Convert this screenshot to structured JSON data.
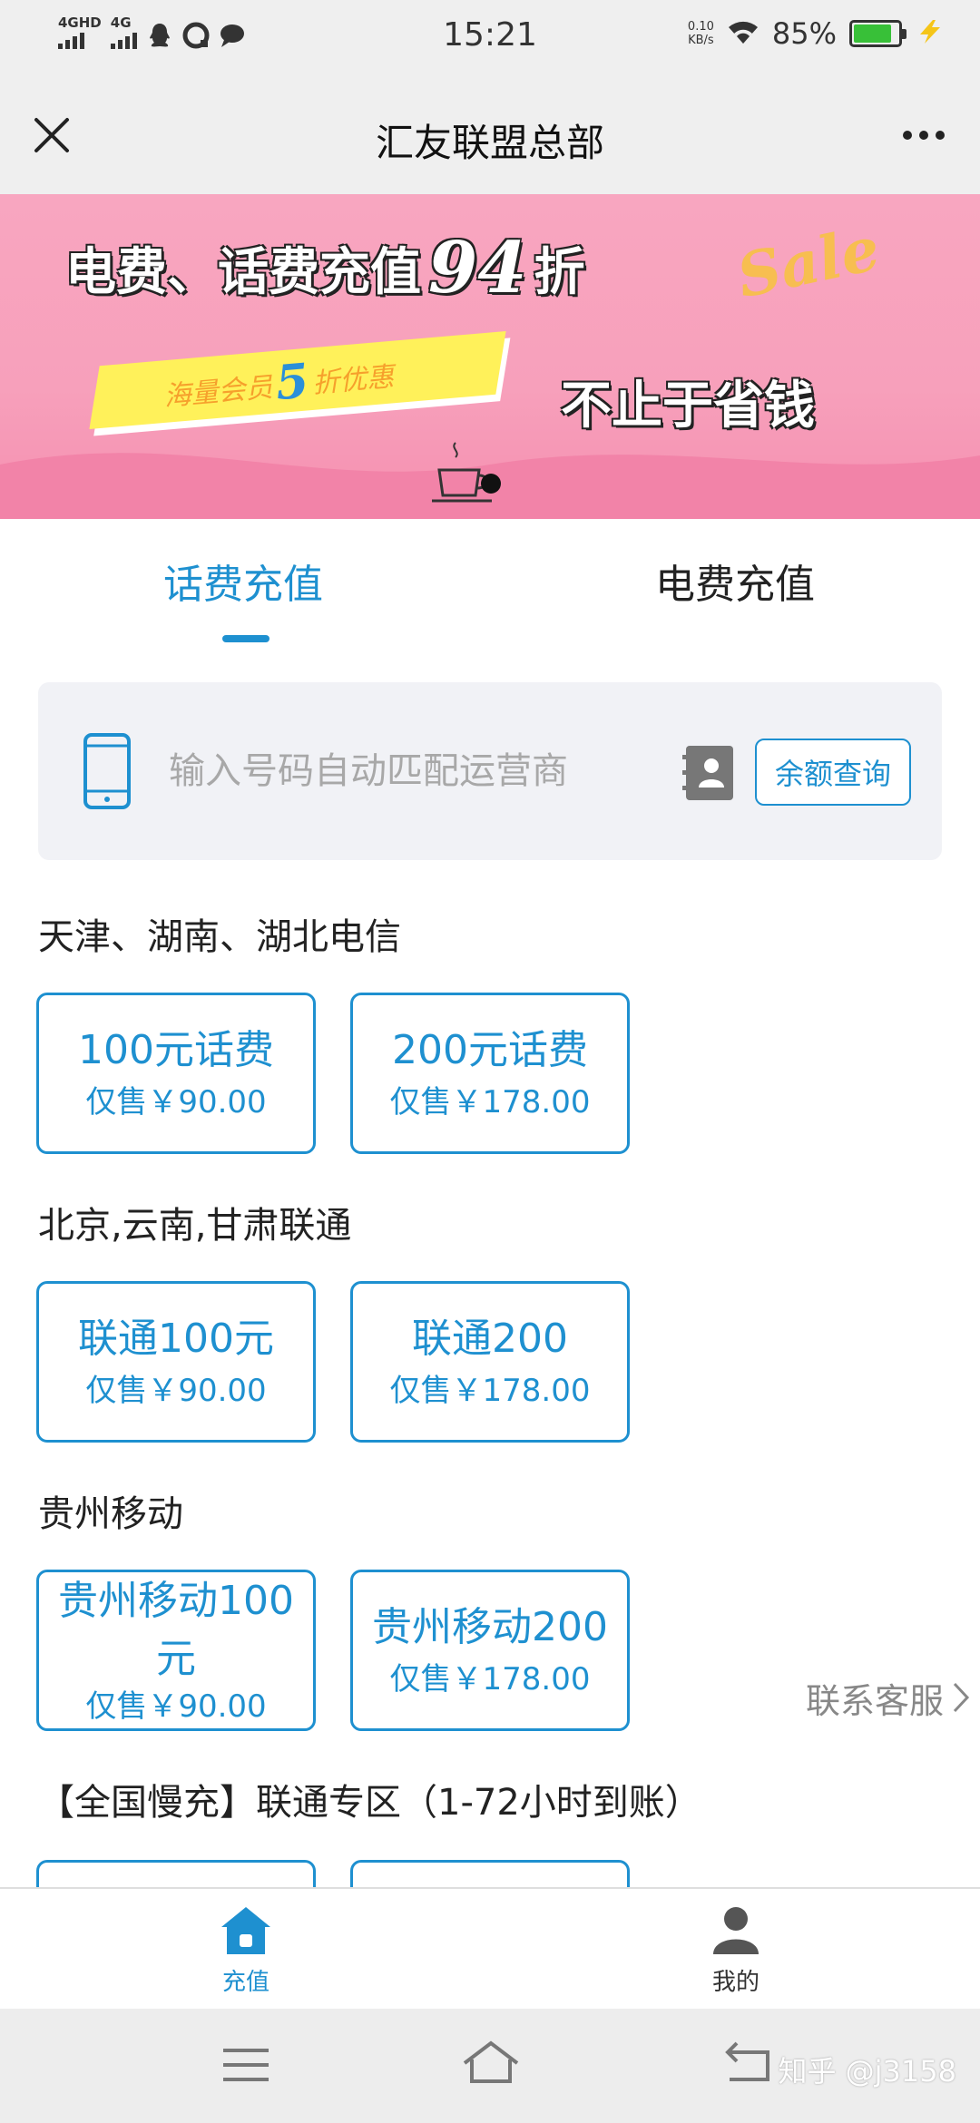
{
  "status_bar": {
    "signal_1": "4GHD",
    "signal_2": "4G",
    "time": "15:21",
    "net_speed_value": "0.10",
    "net_speed_unit": "KB/s",
    "battery_percent": "85%",
    "battery_level": 0.85
  },
  "title_bar": {
    "title": "汇友联盟总部"
  },
  "banner": {
    "headline_prefix": "电费、话费充值",
    "headline_num": "94",
    "headline_suffix": "折",
    "sale_text": "Sale",
    "ribbon_prefix": "海量会员",
    "ribbon_num": "5",
    "ribbon_suffix": "折优惠",
    "subline": "不止于省钱"
  },
  "tabs": [
    {
      "label": "话费充值",
      "active": true
    },
    {
      "label": "电费充值",
      "active": false
    }
  ],
  "input": {
    "placeholder": "输入号码自动匹配运营商",
    "balance_button": "余额查询"
  },
  "sections": [
    {
      "title": "天津、湖南、湖北电信",
      "cards": [
        {
          "name": "100元话费",
          "price": "仅售￥90.00"
        },
        {
          "name": "200元话费",
          "price": "仅售￥178.00"
        }
      ]
    },
    {
      "title": "北京,云南,甘肃联通",
      "cards": [
        {
          "name": "联通100元",
          "price": "仅售￥90.00"
        },
        {
          "name": "联通200",
          "price": "仅售￥178.00"
        }
      ]
    },
    {
      "title": "贵州移动",
      "cards": [
        {
          "name": "贵州移动100元",
          "price": "仅售￥90.00"
        },
        {
          "name": "贵州移动200",
          "price": "仅售￥178.00"
        }
      ]
    },
    {
      "title": "【全国慢充】联通专区（1-72小时到账）",
      "cards": []
    }
  ],
  "floating": {
    "service_label": "联系客服"
  },
  "bottom_nav": [
    {
      "label": "充值",
      "icon": "home-icon",
      "active": true
    },
    {
      "label": "我的",
      "icon": "user-icon",
      "active": false
    }
  ],
  "watermark": "知乎 @j3158",
  "colors": {
    "accent": "#1e90d0",
    "banner_pink": "#f8a6c0"
  }
}
